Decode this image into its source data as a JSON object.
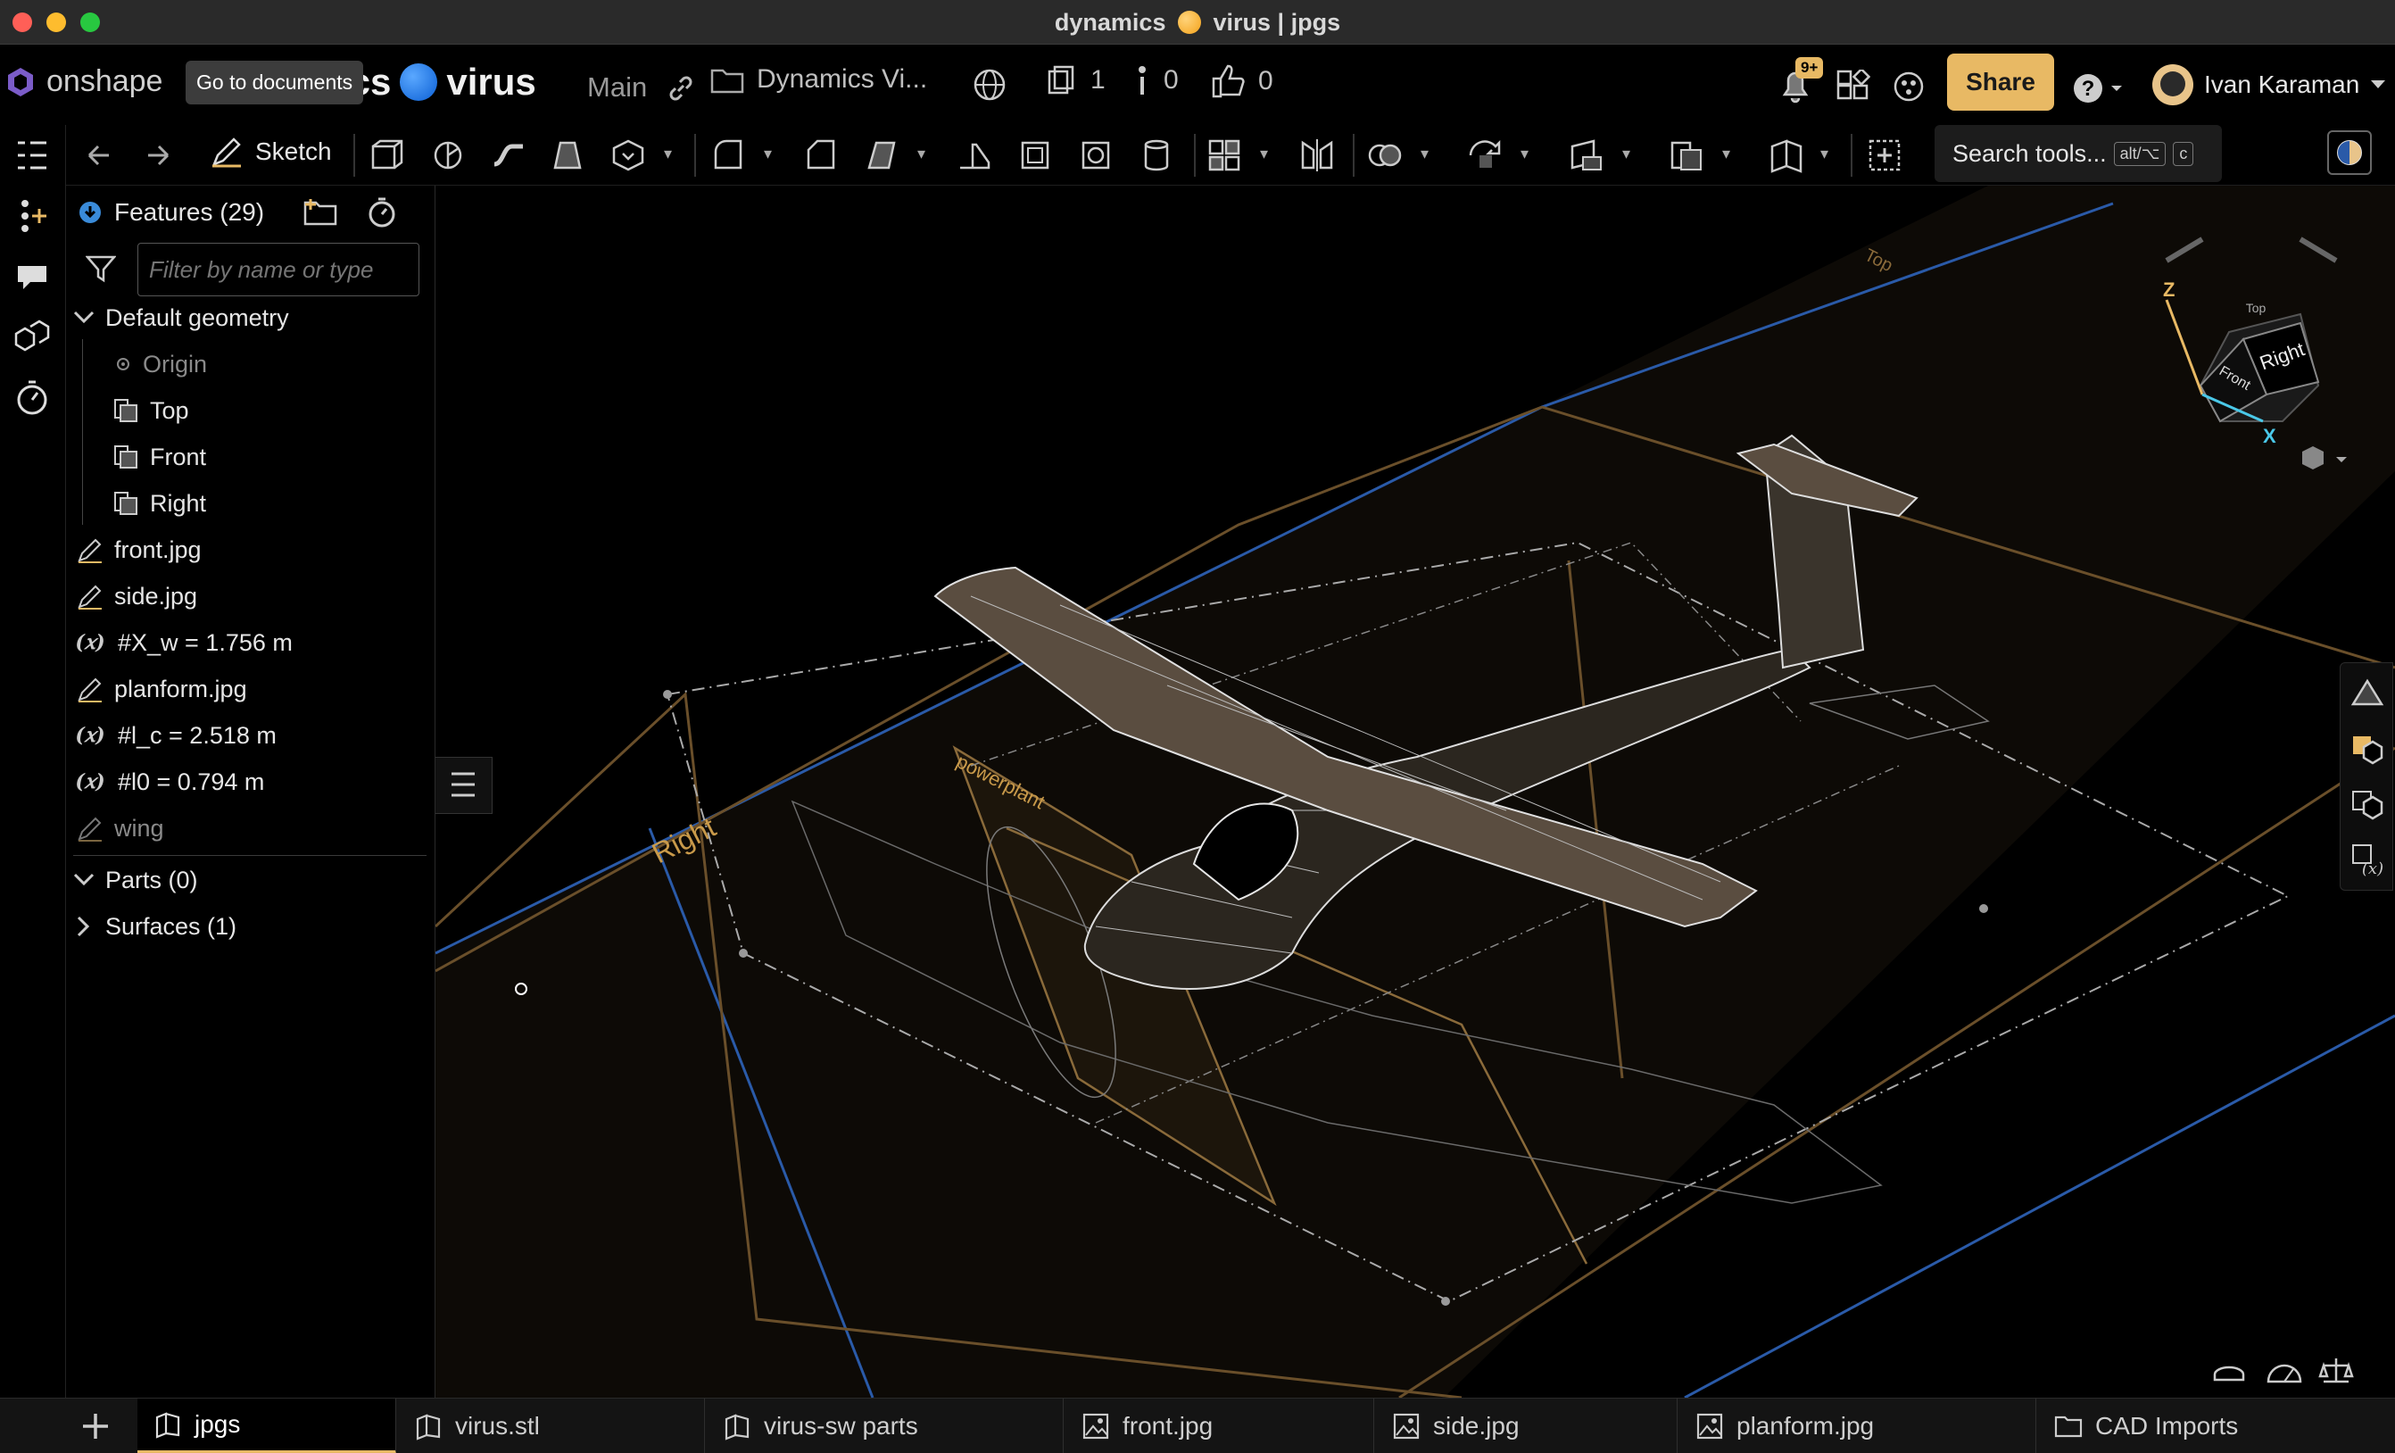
{
  "window": {
    "title_prefix": "dynamics",
    "title_suffix": "virus | jpgs"
  },
  "header": {
    "logo_text": "onshape",
    "tooltip": "Go to documents",
    "doc_name_partial": "ics",
    "doc_name": "virus",
    "branch": "Main",
    "folder": "Dynamics Vi...",
    "versions_count": "1",
    "comments_count": "0",
    "likes_count": "0",
    "notifications_badge": "9+",
    "share_label": "Share",
    "user_name": "Ivan Karaman"
  },
  "toolbar": {
    "sketch_label": "Sketch",
    "search_label": "Search tools...",
    "shortcut_1": "alt/⌥",
    "shortcut_2": "c"
  },
  "features": {
    "header": "Features (29)",
    "filter_placeholder": "Filter by name or type",
    "default_geometry": "Default geometry",
    "origin": "Origin",
    "planes": [
      "Top",
      "Front",
      "Right"
    ],
    "items": [
      {
        "type": "sketch",
        "label": "front.jpg"
      },
      {
        "type": "sketch",
        "label": "side.jpg"
      },
      {
        "type": "variable",
        "label": "#X_w = 1.756 m"
      },
      {
        "type": "sketch",
        "label": "planform.jpg"
      },
      {
        "type": "variable",
        "label": "#l_c = 2.518 m"
      },
      {
        "type": "variable",
        "label": "#l0 = 0.794 m"
      },
      {
        "type": "sketch",
        "label": "wing"
      }
    ],
    "parts": "Parts (0)",
    "surfaces": "Surfaces (1)"
  },
  "viewport": {
    "plane_labels": {
      "top": "Top",
      "right": "Right",
      "powerplant": "powerplant"
    },
    "view_cube": {
      "right": "Right",
      "front": "Front",
      "top": "Top",
      "axis_z": "Z",
      "axis_x": "X"
    }
  },
  "tabs": [
    {
      "label": "jpgs",
      "active": true
    },
    {
      "label": "virus.stl",
      "active": false
    },
    {
      "label": "virus-sw parts",
      "active": false
    },
    {
      "label": "front.jpg",
      "active": false
    },
    {
      "label": "side.jpg",
      "active": false
    },
    {
      "label": "planform.jpg",
      "active": false
    },
    {
      "label": "CAD Imports",
      "active": false
    }
  ],
  "colors": {
    "accent": "#e8b964",
    "plane_orange": "#8a6a3a",
    "plane_blue": "#2a5aa8",
    "bg": "#000000"
  }
}
